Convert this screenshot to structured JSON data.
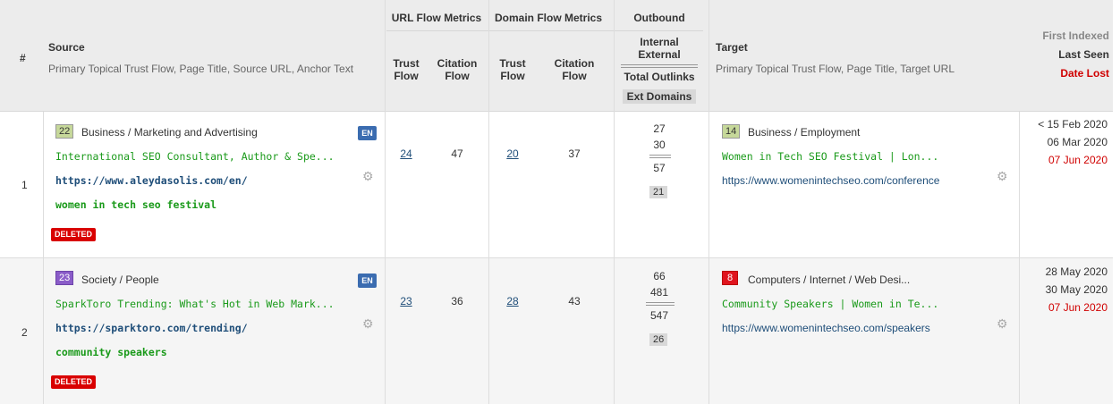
{
  "header": {
    "index": "#",
    "source_title": "Source",
    "source_sub": "Primary Topical Trust Flow, Page Title, Source URL, Anchor Text",
    "url_flow": "URL Flow Metrics",
    "domain_flow": "Domain Flow Metrics",
    "outbound": "Outbound",
    "trust_flow": "Trust Flow",
    "citation_flow": "Citation Flow",
    "internal": "Internal",
    "external": "External",
    "total_outlinks": "Total Outlinks",
    "ext_domains": "Ext Domains",
    "target_title": "Target",
    "target_sub": "Primary Topical Trust Flow, Page Title, Target URL",
    "first_indexed": "First Indexed",
    "last_seen": "Last Seen",
    "date_lost": "Date Lost"
  },
  "rows": [
    {
      "index": "1",
      "source_topic_score": "22",
      "source_topic": "Business / Marketing and Advertising",
      "lang": "EN",
      "source_title": "International SEO Consultant, Author & Spe...",
      "source_url": "https://www.aleydasolis.com/en/",
      "anchor": "women in tech seo festival",
      "status": "DELETED",
      "url_tf": "24",
      "url_cf": "47",
      "dom_tf": "20",
      "dom_cf": "37",
      "internal": "27",
      "external": "30",
      "total": "57",
      "ext_domains": "21",
      "target_topic_score": "14",
      "target_topic": "Business / Employment",
      "target_title": "Women in Tech SEO Festival | Lon...",
      "target_url": "https://www.womenintechseo.com/conference",
      "first_indexed": "< 15 Feb 2020",
      "last_seen": "06 Mar 2020",
      "date_lost": "07 Jun 2020"
    },
    {
      "index": "2",
      "source_topic_score": "23",
      "source_topic": "Society / People",
      "lang": "EN",
      "source_title": "SparkToro Trending: What's Hot in Web Mark...",
      "source_url": "https://sparktoro.com/trending/",
      "anchor": "community speakers",
      "status": "DELETED",
      "url_tf": "23",
      "url_cf": "36",
      "dom_tf": "28",
      "dom_cf": "43",
      "internal": "66",
      "external": "481",
      "total": "547",
      "ext_domains": "26",
      "target_topic_score": "8",
      "target_topic": "Computers / Internet / Web Desi...",
      "target_title": "Community Speakers | Women in Te...",
      "target_url": "https://www.womenintechseo.com/speakers",
      "first_indexed": "28 May 2020",
      "last_seen": "30 May 2020",
      "date_lost": "07 Jun 2020"
    }
  ],
  "colors": {
    "badge_22": "#c6d89a",
    "badge_23": "#8a5cc8",
    "badge_14": "#c6d89a",
    "badge_8": "#e0141e",
    "deleted": "#d90000",
    "lang": "#3b6cb0",
    "title_green": "#1a9a1a",
    "url_blue": "#1f4e79"
  },
  "icons": [
    "gear-icon"
  ]
}
